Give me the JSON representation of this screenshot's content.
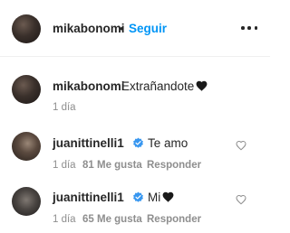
{
  "header": {
    "username": "mikabonomi",
    "separator": "•",
    "follow_label": "Seguir"
  },
  "caption": {
    "username": "mikabonomi",
    "text": "Extrañandote",
    "time": "1 día"
  },
  "comments": [
    {
      "username": "juanittinelli1",
      "text": "Te amo",
      "time": "1 día",
      "likes": "81 Me gusta",
      "reply": "Responder",
      "has_heart": false
    },
    {
      "username": "juanittinelli1",
      "text": "Mi",
      "time": "1 día",
      "likes": "65 Me gusta",
      "reply": "Responder",
      "has_heart": true
    }
  ],
  "colors": {
    "accent": "#0095f6",
    "text": "#262626",
    "muted": "#8e8e8e",
    "verified": "#3897f0"
  },
  "icons": [
    "more-options-icon",
    "verified-badge-icon",
    "black-heart-emoji",
    "like-heart-icon"
  ]
}
